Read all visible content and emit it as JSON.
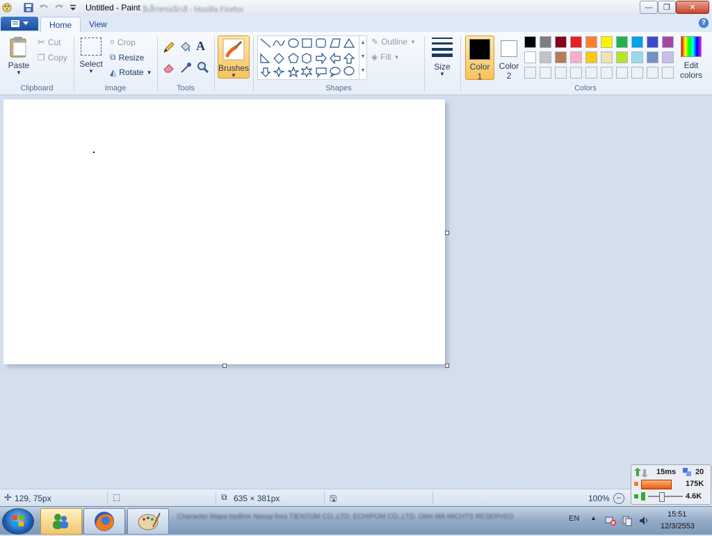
{
  "window": {
    "title": "Untitled - Paint",
    "title_ghost": "อิเล็กทรอนิกส์ - Mozilla Firefox",
    "minimize": "—",
    "restore": "❐",
    "close": "✕"
  },
  "ribbon": {
    "tabs": [
      "Home",
      "View"
    ],
    "help": "?",
    "clipboard": {
      "label": "Clipboard",
      "paste": "Paste",
      "cut": "Cut",
      "copy": "Copy"
    },
    "image": {
      "label": "Image",
      "select": "Select",
      "crop": "Crop",
      "resize": "Resize",
      "rotate": "Rotate"
    },
    "tools": {
      "label": "Tools"
    },
    "brushes": "Brushes",
    "shapes": {
      "label": "Shapes",
      "outline": "Outline",
      "fill": "Fill"
    },
    "size": "Size",
    "color1": {
      "line1": "Color",
      "line2": "1"
    },
    "color2": {
      "line1": "Color",
      "line2": "2"
    },
    "colors_label": "Colors",
    "edit_colors": {
      "line1": "Edit",
      "line2": "colors"
    },
    "palette_row1": [
      "#000000",
      "#7f7f7f",
      "#880015",
      "#ed1c24",
      "#ff7f27",
      "#fff200",
      "#22b14c",
      "#00a2e8",
      "#3f48cc",
      "#a349a4"
    ],
    "palette_row2": [
      "#ffffff",
      "#c3c3c3",
      "#b97a57",
      "#ffaec9",
      "#ffc90e",
      "#efe4b0",
      "#b5e61d",
      "#99d9ea",
      "#7092be",
      "#c8bfe7"
    ]
  },
  "status": {
    "cursor_pos": "129, 75px",
    "canvas_size": "635 × 381px",
    "zoom": "100%",
    "zoom_minus": "−",
    "zoom_plus": "+"
  },
  "monitor": {
    "ping": "15ms",
    "count": "20",
    "down": "175K",
    "up": "4.6K"
  },
  "taskbar": {
    "ghost_text": "Character Mapa bydline Nassp foss TIENTOM CO.,LTD. ECHIPOM CO.,LTD. Otlet MA MICHTS RESERVED",
    "lang": "EN",
    "time": "15:51",
    "date": "12/3/2553"
  }
}
